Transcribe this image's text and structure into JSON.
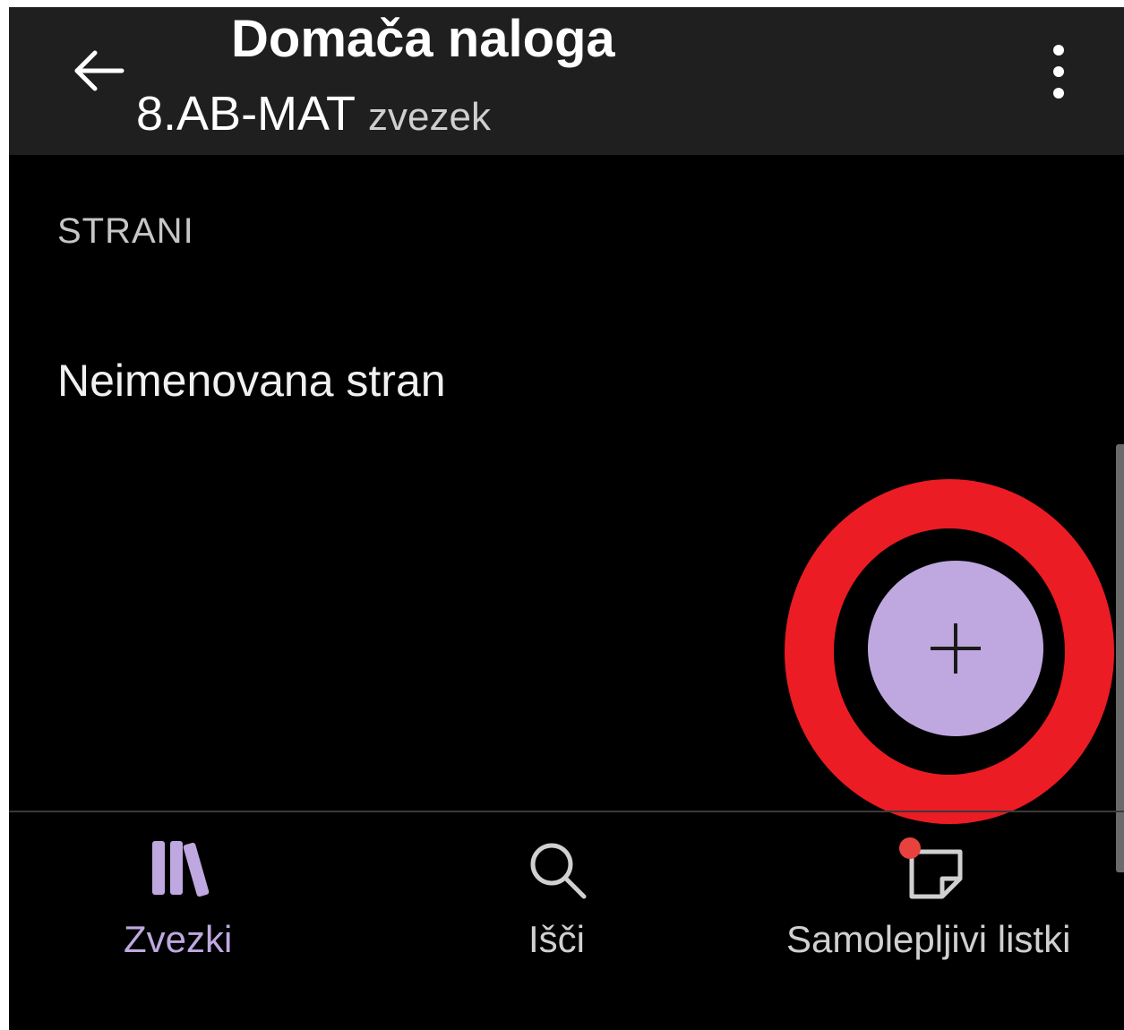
{
  "app_bar": {
    "back_icon": "arrow-left-icon",
    "title": "Domača naloga",
    "notebook": "8.AB-MAT",
    "notebook_type": "zvezek",
    "more_icon": "more-vertical-icon"
  },
  "content": {
    "section_header": "STRANI",
    "pages": [
      {
        "label": "Neimenovana stran"
      }
    ]
  },
  "fab": {
    "icon": "plus-icon",
    "color": "#bfa8e0",
    "highlight_color": "#ec1c24"
  },
  "bottom_nav": {
    "items": [
      {
        "label": "Zvezki",
        "icon": "notebooks-icon",
        "active": true
      },
      {
        "label": "Išči",
        "icon": "search-icon",
        "active": false
      },
      {
        "label": "Samolepljivi listki",
        "icon": "sticky-note-icon",
        "active": false,
        "badge_color": "#e8423f"
      }
    ],
    "active_color": "#bfa8e0",
    "inactive_color": "#d0d0d0"
  }
}
